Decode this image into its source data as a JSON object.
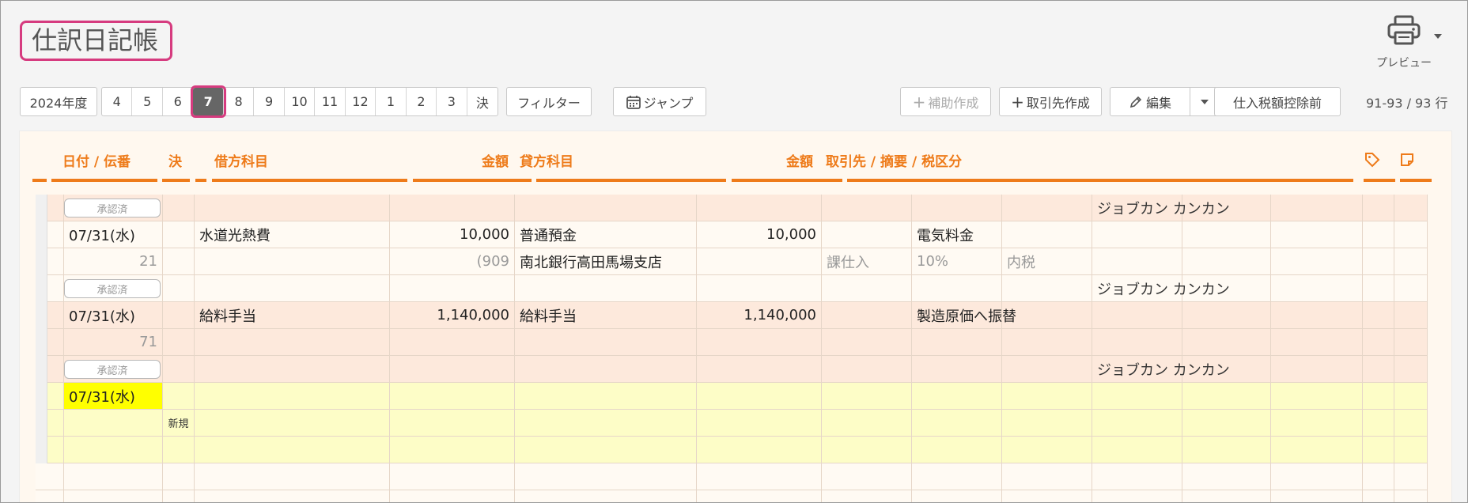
{
  "page": {
    "title": "仕訳日記帳"
  },
  "print": {
    "label": "プレビュー"
  },
  "toolbar": {
    "year": "2024年度",
    "months": [
      "4",
      "5",
      "6",
      "7",
      "8",
      "9",
      "10",
      "11",
      "12",
      "1",
      "2",
      "3",
      "決"
    ],
    "active_month": "7",
    "filter": "フィルター",
    "jump": "ジャンプ",
    "sub_create": "補助作成",
    "partner_create": "取引先作成",
    "edit": "編集",
    "tax_mode": "仕入税額控除前",
    "count": "91-93 / 93 行"
  },
  "columns": {
    "date_no": "日付 / 伝番",
    "settle": "決",
    "debit_account": "借方科目",
    "debit_amount": "金額",
    "credit_account": "貸方科目",
    "credit_amount": "金額",
    "partner": "取引先 / 摘要 / 税区分"
  },
  "entries": [
    {
      "badge": "承認済",
      "user": "ジョブカン カンカン"
    },
    {
      "date": "07/31(水)",
      "no": "21",
      "debit_account": "水道光熱費",
      "debit_amount": "10,000",
      "debit_sub": "(909",
      "credit_account": "普通預金",
      "credit_amount": "10,000",
      "credit_sub": "南北銀行高田馬場支店",
      "memo": "電気料金",
      "tax_type": "課仕入",
      "tax_rate": "10%",
      "tax_incl": "内税",
      "badge": "承認済",
      "user": "ジョブカン カンカン"
    },
    {
      "date": "07/31(水)",
      "no": "71",
      "debit_account": "給料手当",
      "debit_amount": "1,140,000",
      "credit_account": "給料手当",
      "credit_amount": "1,140,000",
      "memo": "製造原価へ振替",
      "badge": "承認済",
      "user": "ジョブカン カンカン"
    },
    {
      "date": "07/31(水)",
      "new_label": "新規"
    }
  ]
}
